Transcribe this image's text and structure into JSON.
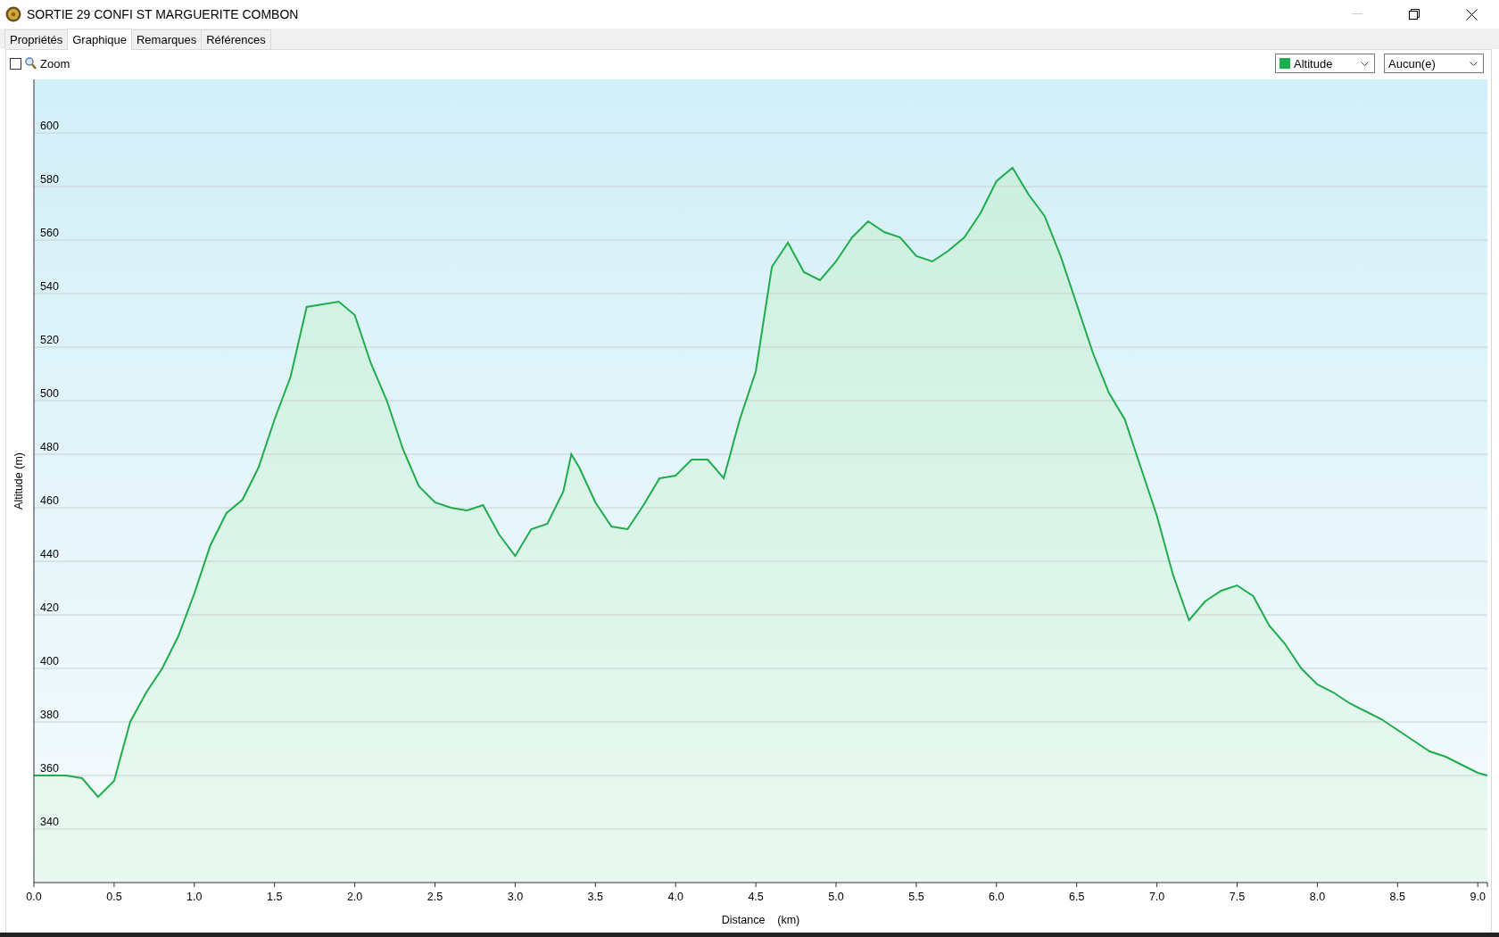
{
  "window": {
    "title": "SORTIE 29 CONFI ST MARGUERITE COMBON"
  },
  "tabs": [
    {
      "label": "Propriétés",
      "selected": false
    },
    {
      "label": "Graphique",
      "selected": true
    },
    {
      "label": "Remarques",
      "selected": false
    },
    {
      "label": "Références",
      "selected": false
    }
  ],
  "toolbar": {
    "zoom": {
      "label": "Zoom",
      "checked": false
    },
    "second_select": {
      "value": "Aucun(e)"
    }
  },
  "chart_data": {
    "type": "area",
    "grid": true,
    "xlabel": "Distance    (km)",
    "ylabel": "Altitude (m)",
    "x": [
      0,
      0.1,
      0.2,
      0.3,
      0.4,
      0.5,
      0.6,
      0.7,
      0.8,
      0.9,
      1.0,
      1.1,
      1.2,
      1.3,
      1.4,
      1.5,
      1.6,
      1.7,
      1.8,
      1.9,
      2.0,
      2.1,
      2.2,
      2.3,
      2.4,
      2.5,
      2.6,
      2.7,
      2.8,
      2.9,
      3.0,
      3.1,
      3.2,
      3.3,
      3.35,
      3.4,
      3.5,
      3.6,
      3.7,
      3.8,
      3.9,
      4.0,
      4.1,
      4.2,
      4.3,
      4.4,
      4.5,
      4.6,
      4.7,
      4.8,
      4.9,
      5.0,
      5.1,
      5.2,
      5.3,
      5.4,
      5.5,
      5.6,
      5.7,
      5.8,
      5.9,
      6.0,
      6.1,
      6.2,
      6.3,
      6.4,
      6.5,
      6.6,
      6.7,
      6.8,
      6.9,
      7.0,
      7.1,
      7.2,
      7.3,
      7.4,
      7.5,
      7.6,
      7.7,
      7.8,
      7.9,
      8.0,
      8.1,
      8.2,
      8.3,
      8.4,
      8.5,
      8.6,
      8.7,
      8.8,
      8.9,
      9.0,
      9.06
    ],
    "series": [
      {
        "name": "Altitude",
        "color": "#1fad4c",
        "values": [
          360,
          360,
          360,
          359,
          352,
          358,
          380,
          391,
          400,
          412,
          428,
          446,
          458,
          463,
          475,
          493,
          509,
          535,
          536,
          537,
          532,
          514,
          500,
          482,
          468,
          462,
          460,
          459,
          461,
          450,
          442,
          452,
          454,
          466,
          480,
          475,
          462,
          453,
          452,
          461,
          471,
          472,
          478,
          478,
          471,
          493,
          511,
          550,
          559,
          548,
          545,
          552,
          561,
          567,
          563,
          561,
          554,
          552,
          556,
          561,
          570,
          582,
          587,
          577,
          569,
          554,
          536,
          518,
          503,
          493,
          475,
          457,
          435,
          418,
          425,
          429,
          431,
          427,
          416,
          409,
          400,
          394,
          391,
          387,
          384,
          381,
          377,
          373,
          369,
          367,
          364,
          361,
          360
        ]
      }
    ],
    "xlim": [
      0,
      9.06
    ],
    "ylim": [
      320,
      620
    ],
    "xticks": [
      {
        "value": 0,
        "label": "0.0"
      },
      {
        "value": 0.5,
        "label": "0.5"
      },
      {
        "value": 1,
        "label": "1.0"
      },
      {
        "value": 1.5,
        "label": "1.5"
      },
      {
        "value": 2,
        "label": "2.0"
      },
      {
        "value": 2.5,
        "label": "2.5"
      },
      {
        "value": 3,
        "label": "3.0"
      },
      {
        "value": 3.5,
        "label": "3.5"
      },
      {
        "value": 4,
        "label": "4.0"
      },
      {
        "value": 4.5,
        "label": "4.5"
      },
      {
        "value": 5,
        "label": "5.0"
      },
      {
        "value": 5.5,
        "label": "5.5"
      },
      {
        "value": 6,
        "label": "6.0"
      },
      {
        "value": 6.5,
        "label": "6.5"
      },
      {
        "value": 7,
        "label": "7.0"
      },
      {
        "value": 7.5,
        "label": "7.5"
      },
      {
        "value": 8,
        "label": "8.0"
      },
      {
        "value": 8.5,
        "label": "8.5"
      },
      {
        "value": 9,
        "label": "9.0"
      }
    ],
    "yticks": [
      340,
      360,
      380,
      400,
      420,
      440,
      460,
      480,
      500,
      520,
      540,
      560,
      580,
      600
    ]
  }
}
